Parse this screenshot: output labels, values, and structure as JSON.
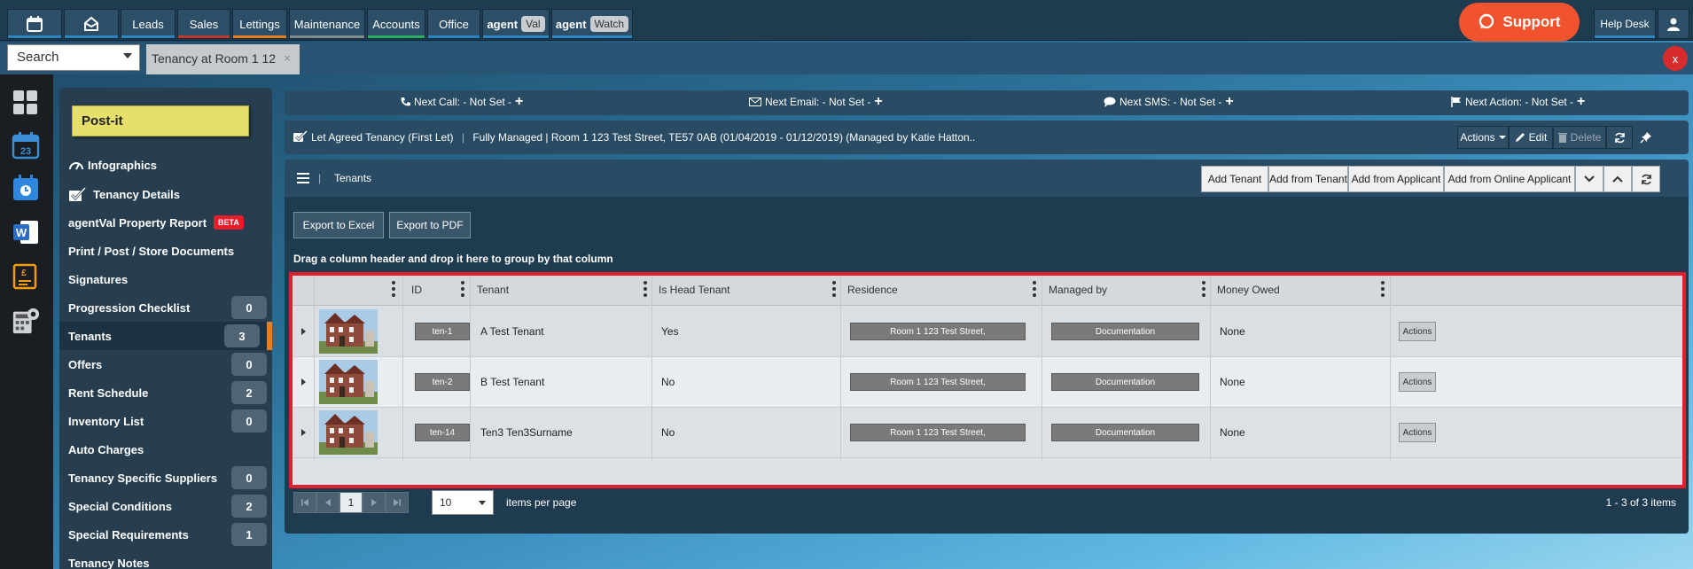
{
  "topnav": {
    "tabs": [
      {
        "label": "",
        "icon": "calendar-icon",
        "color": "#2e86c1"
      },
      {
        "label": "",
        "icon": "inbox-icon",
        "color": "#2e86c1"
      },
      {
        "label": "Leads",
        "color": "#2e86c1"
      },
      {
        "label": "Sales",
        "color": "#c0392b"
      },
      {
        "label": "Lettings",
        "color": "#e67e22"
      },
      {
        "label": "Maintenance",
        "color": "#7f8c8d"
      },
      {
        "label": "Accounts",
        "color": "#27ae60"
      },
      {
        "label": "Office",
        "color": "#2e86c1"
      },
      {
        "label": "agent",
        "pill": "Val",
        "color": "#2e86c1"
      },
      {
        "label": "agent",
        "pill": "Watch",
        "color": "#2e86c1"
      }
    ],
    "support_label": "Support",
    "helpdesk_label": "Help Desk"
  },
  "secondbar": {
    "search_label": "Search",
    "open_tab": "Tenancy at Room 1 12",
    "tab_close": "×",
    "close_all": "x"
  },
  "sidebar": {
    "postit": "Post-it",
    "items": [
      {
        "label": "Infographics",
        "badge": null
      },
      {
        "label": "Tenancy Details",
        "badge": null
      },
      {
        "label": "agentVal Property Report",
        "badge": null,
        "beta": "BETA"
      },
      {
        "label": "Print / Post / Store Documents",
        "badge": null
      },
      {
        "label": "Signatures",
        "badge": null
      },
      {
        "label": "Progression Checklist",
        "badge": "0"
      },
      {
        "label": "Tenants",
        "badge": "3",
        "active": true
      },
      {
        "label": "Offers",
        "badge": "0"
      },
      {
        "label": "Rent Schedule",
        "badge": "2"
      },
      {
        "label": "Inventory List",
        "badge": "0"
      },
      {
        "label": "Auto Charges",
        "badge": null
      },
      {
        "label": "Tenancy Specific Suppliers",
        "badge": "0"
      },
      {
        "label": "Special Conditions",
        "badge": "2"
      },
      {
        "label": "Special Requirements",
        "badge": "1"
      },
      {
        "label": "Tenancy Notes",
        "badge": null
      }
    ]
  },
  "nextbar": {
    "call": "Next Call: - Not Set -",
    "email": "Next Email: - Not Set -",
    "sms": "Next SMS: - Not Set -",
    "action": "Next Action: - Not Set -",
    "plus": "+"
  },
  "tenancy": {
    "type": "Let Agreed Tenancy (First Let)",
    "separator": "|",
    "summary": "Fully Managed | Room 1 123 Test Street, TE57 0AB (01/04/2019 - 01/12/2019) (Managed by Katie Hatton..",
    "actions_label": "Actions",
    "edit_label": "Edit",
    "delete_label": "Delete"
  },
  "tenants_bar": {
    "title": "Tenants",
    "separator": "|",
    "buttons": [
      "Add Tenant",
      "Add from Tenant",
      "Add from Applicant",
      "Add from Online Applicant"
    ]
  },
  "grid": {
    "export_excel": "Export to Excel",
    "export_pdf": "Export to PDF",
    "group_hint": "Drag a column header and drop it here to group by that column",
    "columns": [
      "ID",
      "Tenant",
      "Is Head Tenant",
      "Residence",
      "Managed by",
      "Money Owed"
    ],
    "rows": [
      {
        "id": "ten-1",
        "tenant": "A Test Tenant",
        "head": "Yes",
        "residence": "Room 1 123 Test Street,",
        "managed": "Documentation",
        "owed": "None",
        "action": "Actions"
      },
      {
        "id": "ten-2",
        "tenant": "B Test Tenant",
        "head": "No",
        "residence": "Room 1 123 Test Street,",
        "managed": "Documentation",
        "owed": "None",
        "action": "Actions"
      },
      {
        "id": "ten-14",
        "tenant": "Ten3 Ten3Surname",
        "head": "No",
        "residence": "Room 1 123 Test Street,",
        "managed": "Documentation",
        "owed": "None",
        "action": "Actions"
      }
    ],
    "pager": {
      "current_page": "1",
      "page_size": "10",
      "items_per_page": "items per page",
      "summary": "1 - 3 of 3 items"
    }
  }
}
